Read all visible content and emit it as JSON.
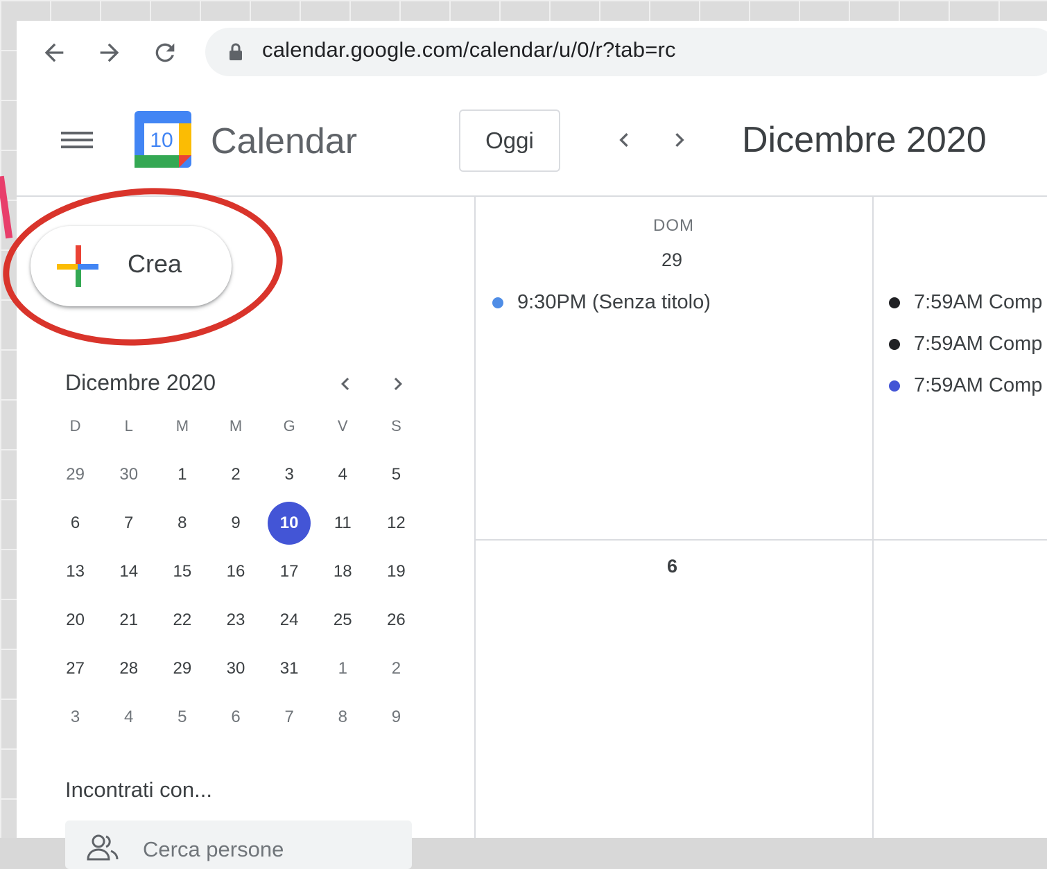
{
  "browser": {
    "url": "calendar.google.com/calendar/u/0/r?tab=rc"
  },
  "header": {
    "app_title": "Calendar",
    "logo_number": "10",
    "today_label": "Oggi",
    "month_title": "Dicembre 2020"
  },
  "sidebar": {
    "create_label": "Crea",
    "mini_calendar": {
      "title": "Dicembre 2020",
      "weekdays": [
        "D",
        "L",
        "M",
        "M",
        "G",
        "V",
        "S"
      ],
      "weeks": [
        [
          "29",
          "30",
          "1",
          "2",
          "3",
          "4",
          "5"
        ],
        [
          "6",
          "7",
          "8",
          "9",
          "10",
          "11",
          "12"
        ],
        [
          "13",
          "14",
          "15",
          "16",
          "17",
          "18",
          "19"
        ],
        [
          "20",
          "21",
          "22",
          "23",
          "24",
          "25",
          "26"
        ],
        [
          "27",
          "28",
          "29",
          "30",
          "31",
          "1",
          "2"
        ],
        [
          "3",
          "4",
          "5",
          "6",
          "7",
          "8",
          "9"
        ]
      ],
      "today": "10"
    },
    "meet_title": "Incontrati con...",
    "search_people_placeholder": "Cerca persone"
  },
  "grid": {
    "col1": {
      "weekday": "DOM",
      "day": "29",
      "events": [
        {
          "label": "9:30PM (Senza titolo)",
          "color": "#4f8de6"
        }
      ],
      "next_week_day": "6"
    },
    "col2": {
      "events": [
        {
          "label": "7:59AM Comp",
          "color": "#202124"
        },
        {
          "label": "7:59AM Comp",
          "color": "#202124"
        },
        {
          "label": "7:59AM Comp",
          "color": "#4355d6"
        }
      ]
    }
  },
  "colors": {
    "accent": "#4355d6",
    "annotation": "#d9342b"
  }
}
